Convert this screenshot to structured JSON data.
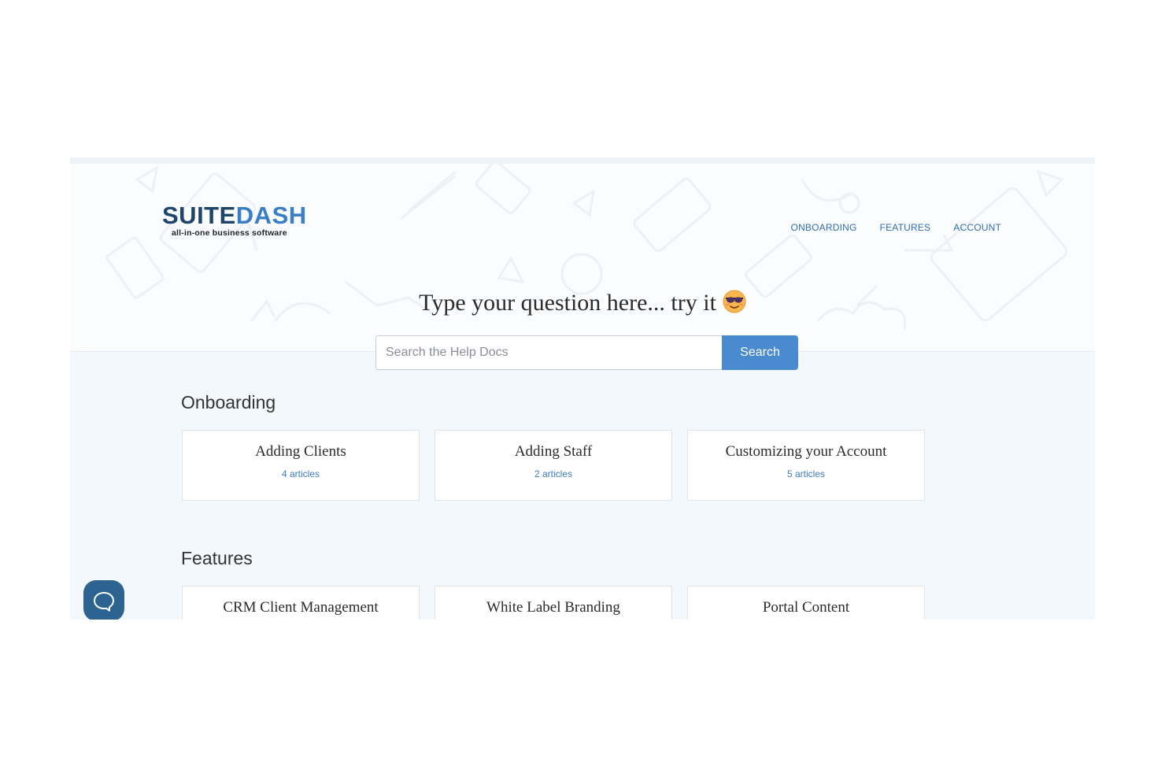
{
  "brand": {
    "name_part1": "SUITE",
    "name_part2": "DASH",
    "tagline": "all-in-one business software"
  },
  "nav": {
    "items": [
      "ONBOARDING",
      "FEATURES",
      "ACCOUNT"
    ]
  },
  "hero": {
    "headline": "Type your question here... try it",
    "emoji_icon": "sunglasses-face-icon"
  },
  "search": {
    "placeholder": "Search the Help Docs",
    "button_label": "Search"
  },
  "sections": [
    {
      "title": "Onboarding",
      "cards": [
        {
          "title": "Adding Clients",
          "count": "4 articles"
        },
        {
          "title": "Adding Staff",
          "count": "2 articles"
        },
        {
          "title": "Customizing your Account",
          "count": "5 articles"
        }
      ]
    },
    {
      "title": "Features",
      "cards": [
        {
          "title": "CRM Client Management"
        },
        {
          "title": "White Label Branding"
        },
        {
          "title": "Portal Content"
        }
      ]
    }
  ],
  "colors": {
    "accent": "#4a8bd0",
    "nav_link": "#2f6ea8",
    "brand_dark": "#20456a",
    "chat_button": "#2c6391"
  }
}
